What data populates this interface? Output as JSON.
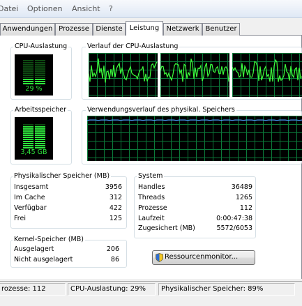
{
  "menu": [
    "Datei",
    "Optionen",
    "Ansicht",
    "?"
  ],
  "tabs": [
    "Anwendungen",
    "Prozesse",
    "Dienste",
    "Leistung",
    "Netzwerk",
    "Benutzer"
  ],
  "active_tab": "Leistung",
  "cpu": {
    "title": "CPU-Auslastung",
    "value": "29 %",
    "fraction": 0.29
  },
  "cpu_history": {
    "title": "Verlauf der CPU-Auslastung"
  },
  "memory": {
    "title": "Arbeitsspeicher",
    "value": "3,45 GB",
    "fraction": 0.89
  },
  "memory_history": {
    "title": "Verwendungsverlauf des physikal. Speichers"
  },
  "physical": {
    "title": "Physikalischer Speicher (MB)",
    "rows": [
      {
        "label": "Insgesamt",
        "value": "3956"
      },
      {
        "label": "Im Cache",
        "value": "312"
      },
      {
        "label": "Verfügbar",
        "value": "422"
      },
      {
        "label": "Frei",
        "value": "125"
      }
    ]
  },
  "system": {
    "title": "System",
    "rows": [
      {
        "label": "Handles",
        "value": "36489"
      },
      {
        "label": "Threads",
        "value": "1265"
      },
      {
        "label": "Prozesse",
        "value": "112"
      },
      {
        "label": "Laufzeit",
        "value": "0:00:47:38"
      },
      {
        "label": "Zugesichert (MB)",
        "value": "5572/6053"
      }
    ]
  },
  "kernel": {
    "title": "Kernel-Speicher (MB)",
    "rows": [
      {
        "label": "Ausgelagert",
        "value": "206"
      },
      {
        "label": "Nicht ausgelagert",
        "value": "86"
      }
    ]
  },
  "resource_monitor_label": "Ressourcenmonitor...",
  "status": {
    "processes": "rozesse: 112",
    "cpu": "CPU-Auslastung: 29%",
    "memory": "Physikalischer Speicher: 89%"
  },
  "colors": {
    "meter_green": "#2ee53c",
    "meter_dim": "#0e4a12",
    "grid": "#0b7a3a",
    "cpu_line": "#3cff3c",
    "mem_line": "#4aa0ff",
    "graph_bg": "#000000"
  },
  "icons": [
    "shield-icon"
  ]
}
